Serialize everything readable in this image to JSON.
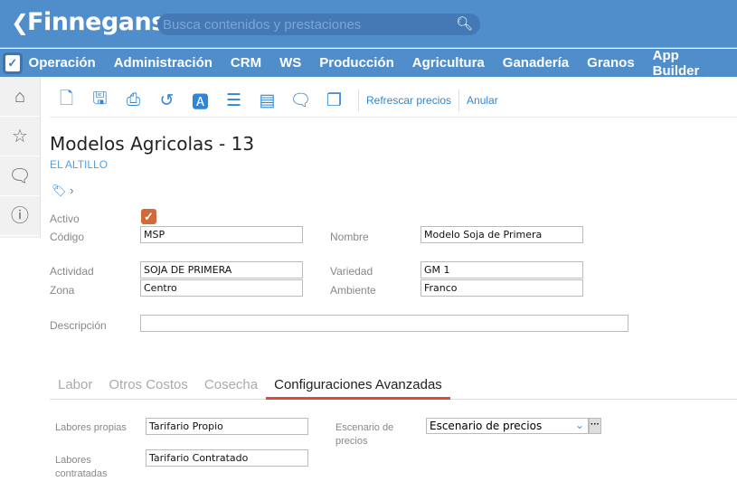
{
  "header": {
    "logo": "Finnegans",
    "search_placeholder": "Busca contenidos y prestaciones"
  },
  "nav": [
    "Operación",
    "Administración",
    "CRM",
    "WS",
    "Producción",
    "Agricultura",
    "Ganadería",
    "Granos",
    "App Builder"
  ],
  "toolbar": {
    "refresh": "Refrescar precios",
    "cancel": "Anular"
  },
  "page": {
    "title": "Modelos Agricolas - 13",
    "subtitle": "EL ALTILLO"
  },
  "form": {
    "activo_label": "Activo",
    "activo_checked": true,
    "codigo_label": "Código",
    "codigo": "MSP",
    "nombre_label": "Nombre",
    "nombre": "Modelo Soja de Primera",
    "actividad_label": "Actividad",
    "actividad": "SOJA DE PRIMERA",
    "variedad_label": "Variedad",
    "variedad": "GM 1",
    "zona_label": "Zona",
    "zona": "Centro",
    "ambiente_label": "Ambiente",
    "ambiente": "Franco",
    "descripcion_label": "Descripción",
    "descripcion": ""
  },
  "tabs": [
    "Labor",
    "Otros Costos",
    "Cosecha",
    "Configuraciones Avanzadas"
  ],
  "advanced": {
    "labores_propias_label": "Labores propias",
    "labores_propias": "Tarifario Propio",
    "labores_contratadas_label": "Labores contratadas",
    "labores_contratadas": "Tarifario Contratado",
    "escenario_label": "Escenario de precios",
    "escenario": "Escenario de precios"
  }
}
